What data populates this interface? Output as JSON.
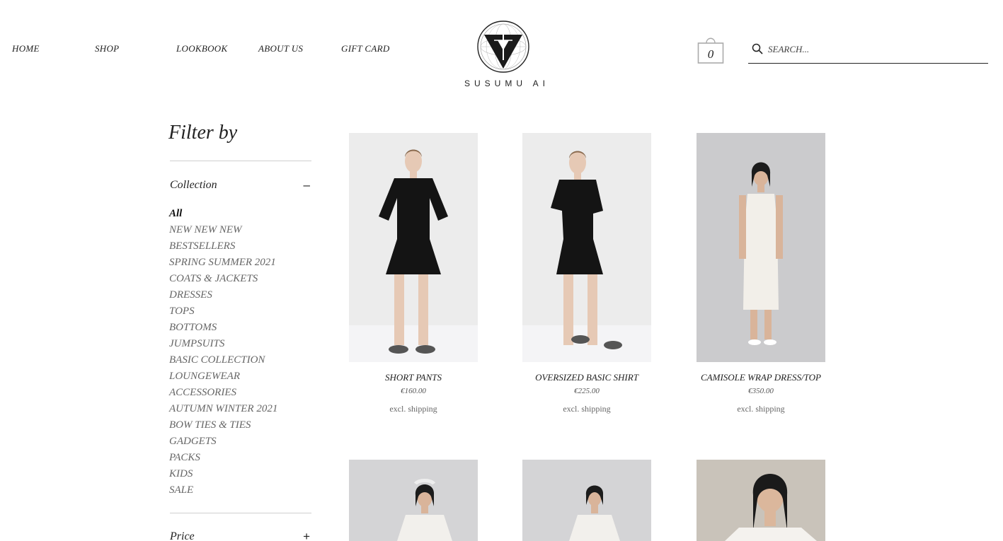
{
  "nav": {
    "items": [
      {
        "label": "HOME"
      },
      {
        "label": "SHOP"
      },
      {
        "label": "LOOKBOOK"
      },
      {
        "label": "ABOUT US"
      },
      {
        "label": "GIFT CARD"
      }
    ]
  },
  "brand": {
    "name": "SUSUMU AI",
    "logo_icon": "triangle-seal-logo"
  },
  "cart": {
    "count": "0",
    "icon": "shopping-bag-icon"
  },
  "search": {
    "placeholder": "SEARCH...",
    "value": "",
    "icon": "search-icon"
  },
  "sidebar": {
    "title": "Filter by",
    "collection": {
      "label": "Collection",
      "toggle": "–",
      "items": [
        {
          "label": "All",
          "active": true
        },
        {
          "label": "NEW NEW NEW"
        },
        {
          "label": "BESTSELLERS"
        },
        {
          "label": "SPRING SUMMER 2021"
        },
        {
          "label": "COATS & JACKETS"
        },
        {
          "label": "DRESSES"
        },
        {
          "label": "TOPS"
        },
        {
          "label": "BOTTOMS"
        },
        {
          "label": "JUMPSUITS"
        },
        {
          "label": "BASIC COLLECTION"
        },
        {
          "label": "LOUNGEWEAR"
        },
        {
          "label": "ACCESSORIES"
        },
        {
          "label": "AUTUMN WINTER 2021"
        },
        {
          "label": "BOW TIES & TIES"
        },
        {
          "label": "GADGETS"
        },
        {
          "label": "PACKS"
        },
        {
          "label": "KIDS"
        },
        {
          "label": "SALE"
        }
      ]
    },
    "price": {
      "label": "Price",
      "toggle": "+"
    }
  },
  "products": [
    {
      "name": "SHORT PANTS",
      "price": "€160.00",
      "shipping": "excl. shipping",
      "garment": "black"
    },
    {
      "name": "OVERSIZED BASIC SHIRT",
      "price": "€225.00",
      "shipping": "excl. shipping",
      "garment": "black"
    },
    {
      "name": "CAMISOLE WRAP DRESS/TOP",
      "price": "€350.00",
      "shipping": "excl. shipping",
      "garment": "white"
    },
    {
      "name": "",
      "price": "",
      "shipping": "",
      "garment": "white"
    },
    {
      "name": "",
      "price": "",
      "shipping": "",
      "garment": "white"
    },
    {
      "name": "",
      "price": "",
      "shipping": "",
      "garment": "white"
    }
  ],
  "colors": {
    "text": "#222222",
    "muted": "#666666",
    "divider": "#cfcfcf",
    "photo_bg": "#e6e6e6"
  }
}
